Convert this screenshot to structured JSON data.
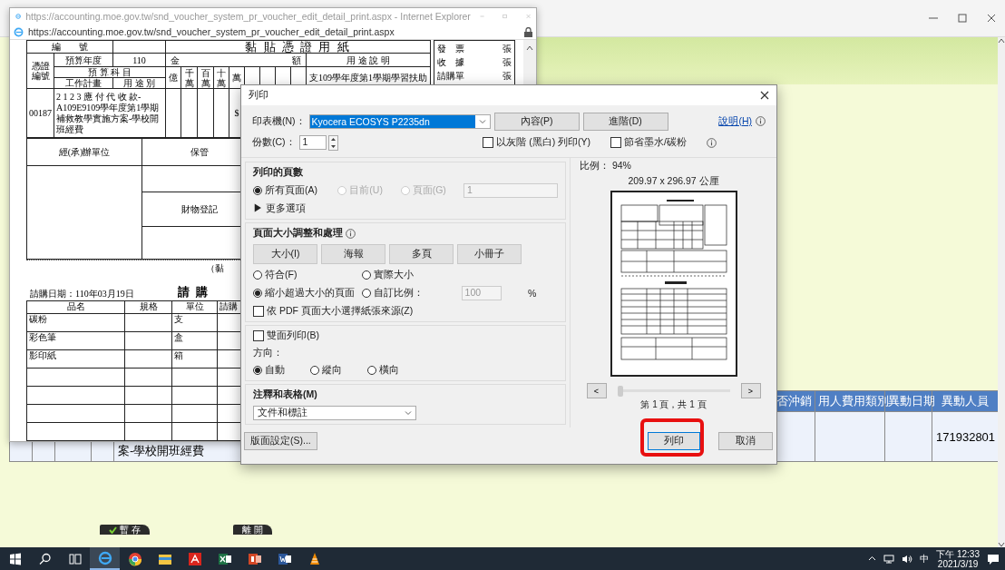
{
  "ie_window": {
    "title": "https://accounting.moe.gov.tw/snd_voucher_system_pr_voucher_edit_detail_print.aspx - Internet Explorer",
    "address": "https://accounting.moe.gov.tw/snd_voucher_system_pr_voucher_edit_detail_print.aspx",
    "voucher": {
      "number_label": "編　　號",
      "form_title": "黏 貼 憑 證 用 紙",
      "attachments": [
        {
          "label": "發　票",
          "unit": "張"
        },
        {
          "label": "收　據",
          "unit": "張"
        },
        {
          "label": "請購單",
          "unit": "張"
        }
      ],
      "voucher_no_label": "憑證編號",
      "budget_year_label": "預算年度",
      "budget_year": "110",
      "amount_left": "金",
      "amount_right": "額",
      "purpose_label": "用 途 說 明",
      "budget_subject_label": "預 算 科 目",
      "digit_labels": [
        "億",
        "千萬",
        "百萬",
        "十萬",
        "萬"
      ],
      "purpose": "支109學年度第1學期學習扶助",
      "work_plan_label": "工作計畫",
      "usage_label": "用 途 別",
      "voucher_no": "00187",
      "subject": "2 1 2 3 應 付 代 收 款-A109E9109學年度第1學期補救教學實施方案-學校開班經費",
      "currency": "$",
      "handler_label": "經(承)辦單位",
      "custody_label": "保管",
      "property_label": "財物登記",
      "paste_note": "（黏"
    },
    "requisition": {
      "date": "請購日期：110年03月19日",
      "title": "請 購",
      "columns": [
        "品名",
        "規格",
        "單位",
        "請購"
      ],
      "rows": [
        {
          "name": "碳粉",
          "unit": "支"
        },
        {
          "name": "彩色筆",
          "unit": "盒"
        },
        {
          "name": "影印紙",
          "unit": "箱"
        }
      ]
    }
  },
  "print_dialog": {
    "title": "列印",
    "printer_label": "印表機(N)：",
    "printer": "Kyocera ECOSYS P2235dn",
    "properties_button": "內容(P)",
    "advanced_button": "進階(D)",
    "help_link": "說明(H)",
    "copies_label": "份數(C)：",
    "copies": "1",
    "options": [
      {
        "label": "以灰階 (黑白) 列印(Y)",
        "checked": false
      },
      {
        "label": "節省墨水/碳粉",
        "checked": false
      }
    ],
    "pages": {
      "heading": "列印的頁數",
      "radios": [
        {
          "label": "所有頁面(A)",
          "selected": true,
          "disabled": false
        },
        {
          "label": "目前(U)",
          "selected": false,
          "disabled": true
        },
        {
          "label": "頁面(G)",
          "selected": false,
          "disabled": true
        }
      ],
      "range": {
        "value": "1",
        "disabled": true
      },
      "more_options": "▶ 更多選項"
    },
    "sizing": {
      "heading": "頁面大小調整和處理",
      "tabs": [
        "大小(I)",
        "海報",
        "多頁",
        "小冊子"
      ],
      "radios": [
        {
          "label": "符合(F)",
          "selected": false
        },
        {
          "label": "實際大小",
          "selected": false
        },
        {
          "label": "縮小超過大小的頁面",
          "selected": true
        },
        {
          "label": "自訂比例：",
          "selected": false
        }
      ],
      "custom_scale": {
        "value": "100",
        "disabled": true
      },
      "percent": "%",
      "paper_source": {
        "label": "依 PDF 頁面大小選擇紙張來源(Z)",
        "checked": false
      }
    },
    "duplex": {
      "label": "雙面列印(B)",
      "checked": false
    },
    "orientation": {
      "label": "方向：",
      "radios": [
        {
          "label": "自動",
          "selected": true
        },
        {
          "label": "縱向",
          "selected": false
        },
        {
          "label": "橫向",
          "selected": false
        }
      ]
    },
    "comments": {
      "heading": "注釋和表格(M)",
      "value": "文件和標註"
    },
    "page_setup_button": "版面設定(S)...",
    "preview": {
      "scale": "比例： 94%",
      "size": "209.97 x 296.97 公厘",
      "prev_button": "<",
      "slider": {
        "level": 0
      },
      "next_button": ">",
      "page_count": "第 1 頁，共 1 頁"
    },
    "print_button": "列印",
    "cancel_button": "取消"
  },
  "background_page": {
    "columns": [
      "否沖銷",
      "用人費用類別",
      "異動日期",
      "異動人員"
    ],
    "row_fragment": "案-學校開班經費",
    "last_cell": "171932801",
    "buttons": [
      {
        "label": "暫 存",
        "kind": "save"
      },
      {
        "label": "離 開",
        "kind": "exit"
      }
    ]
  },
  "taskbar": {
    "apps": [
      {
        "kind": "ie",
        "selected": true
      },
      {
        "kind": "chrome",
        "selected": false
      },
      {
        "kind": "explorer",
        "selected": false
      },
      {
        "kind": "acrobat",
        "selected": false
      },
      {
        "kind": "excel",
        "selected": false
      },
      {
        "kind": "powerpoint",
        "selected": false
      },
      {
        "kind": "word",
        "selected": false
      },
      {
        "kind": "vlc",
        "selected": false
      }
    ],
    "ime": "中",
    "time": "下午 12:33",
    "date": "2021/3/19"
  }
}
